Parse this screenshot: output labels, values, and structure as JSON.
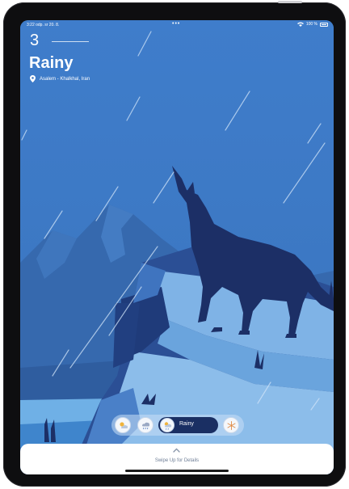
{
  "status_bar": {
    "time_date": "3:22 odp.   sr 20. 8.",
    "center_dots": "•••",
    "battery": "100 %"
  },
  "weather": {
    "temperature": "3",
    "condition": "Rainy",
    "location": "Asalem - Khalkhal, Iran"
  },
  "weather_bar": {
    "items": [
      {
        "icon": "partly-sunny-icon",
        "selected": false
      },
      {
        "icon": "cloud-rain-icon",
        "selected": false
      },
      {
        "icon": "rainy-icon",
        "selected": true,
        "label": "Rainy"
      },
      {
        "icon": "snowy-icon",
        "selected": false
      }
    ]
  },
  "bottom_sheet": {
    "hint": "Swipe Up for Details"
  },
  "colors": {
    "sky": "#3d79c4",
    "mountain": "#3668ac",
    "wolf": "#1c2f66",
    "active_pill": "#1a2f63"
  }
}
